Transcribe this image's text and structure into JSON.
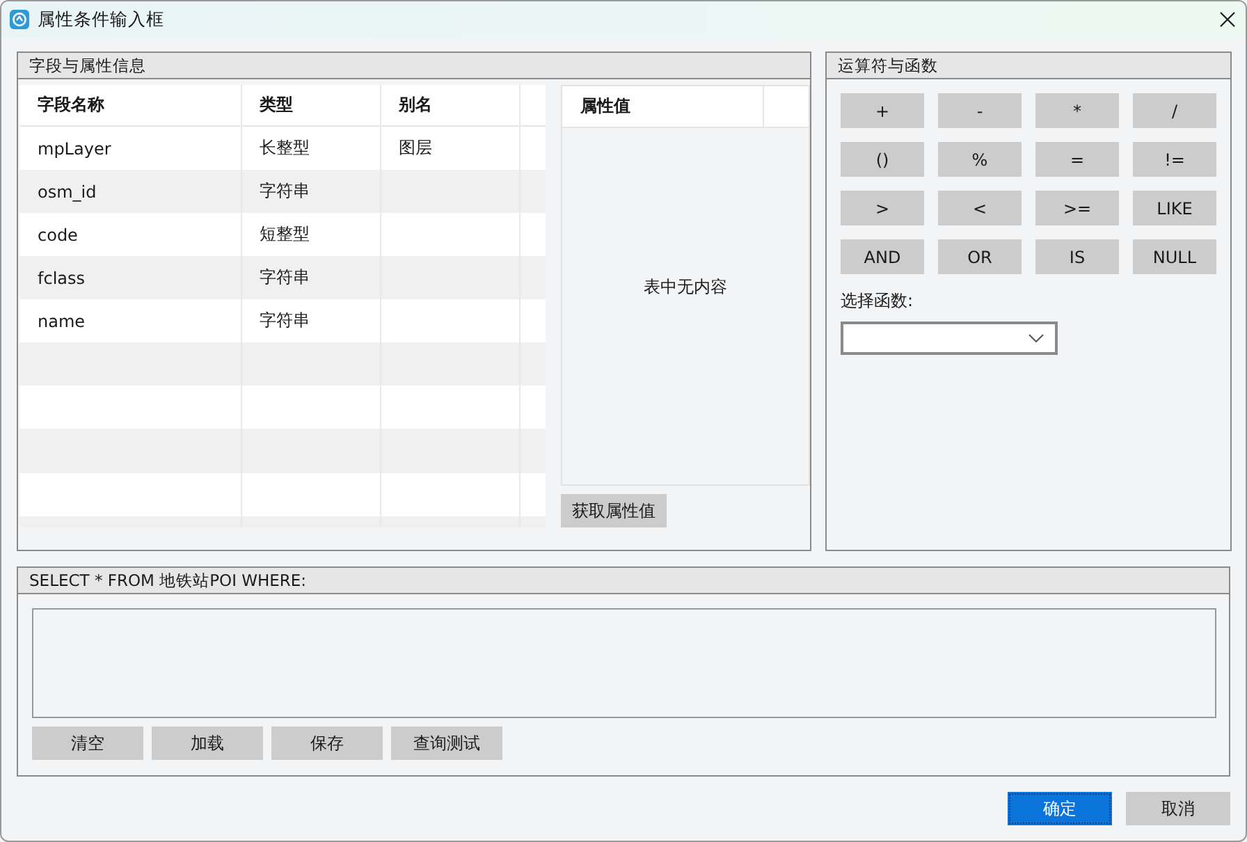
{
  "window": {
    "title": "属性条件输入框"
  },
  "fields_panel": {
    "title": "字段与属性信息",
    "columns": [
      "字段名称",
      "类型",
      "别名"
    ],
    "rows": [
      {
        "name": "mpLayer",
        "type": "长整型",
        "alias": "图层"
      },
      {
        "name": "osm_id",
        "type": "字符串"
      },
      {
        "name": "code",
        "type": "短整型"
      },
      {
        "name": "fclass",
        "type": "字符串"
      },
      {
        "name": "name",
        "type": "字符串"
      }
    ],
    "values_column": "属性值",
    "values_empty": "表中无内容",
    "get_values_button": "获取属性值"
  },
  "operators_panel": {
    "title": "运算符与函数",
    "operators": [
      "+",
      "-",
      "*",
      "/",
      "()",
      "%",
      "=",
      "!=",
      ">",
      "<",
      ">=",
      "LIKE",
      "AND",
      "OR",
      "IS",
      "NULL"
    ],
    "function_label": "选择函数:"
  },
  "query_panel": {
    "title": "SELECT * FROM 地铁站POI WHERE:",
    "buttons": [
      "清空",
      "加载",
      "保存",
      "查询测试"
    ]
  },
  "dialog_buttons": [
    {
      "label": "确定",
      "default": true
    },
    {
      "label": "取消",
      "default": false
    }
  ]
}
